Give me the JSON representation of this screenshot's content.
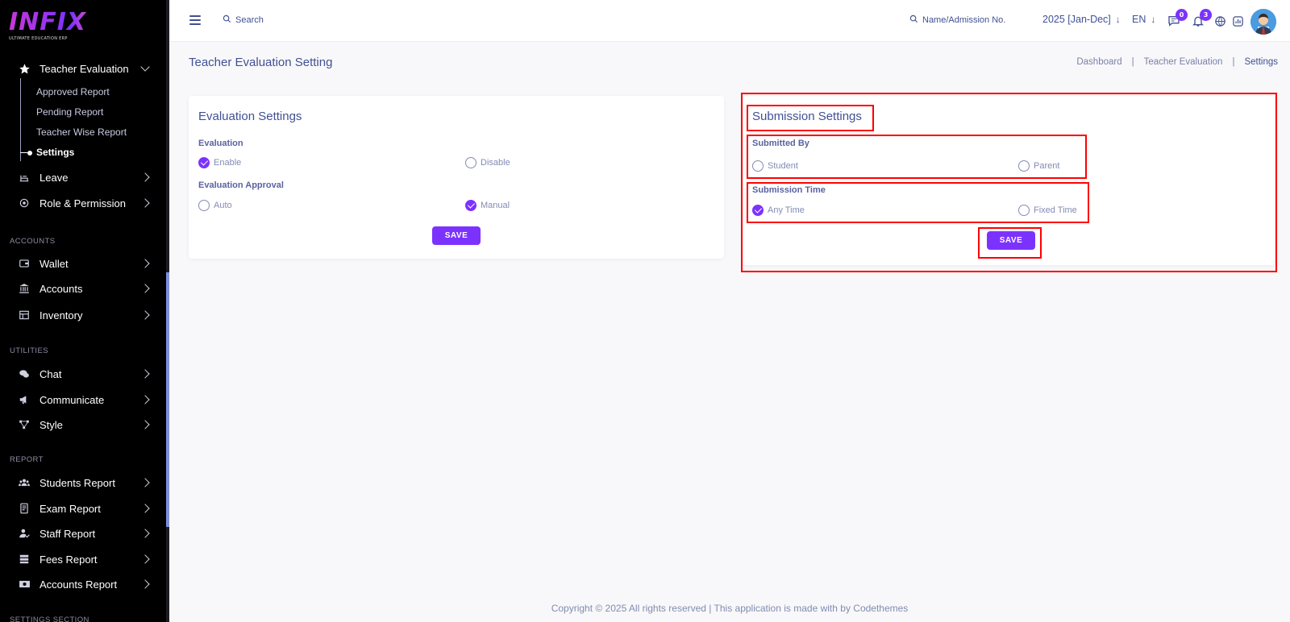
{
  "app": {
    "logo_text": "INFIX",
    "logo_tagline": "ULTIMATE EDUCATION ERP"
  },
  "header": {
    "search_label": "Search",
    "admission_search_label": "Name/Admission No.",
    "session": "2025 [Jan-Dec]",
    "language": "EN",
    "message_count": "0",
    "notification_count": "3"
  },
  "sidebar": {
    "teacher_evaluation": {
      "label": "Teacher Evaluation",
      "sub_items": [
        "Approved Report",
        "Pending Report",
        "Teacher Wise Report",
        "Settings"
      ]
    },
    "items_top": [
      {
        "label": "Leave",
        "icon": "leave-icon"
      },
      {
        "label": "Role & Permission",
        "icon": "role-permission-icon"
      }
    ],
    "sections": [
      {
        "title": "ACCOUNTS",
        "items": [
          "Wallet",
          "Accounts",
          "Inventory"
        ]
      },
      {
        "title": "UTILITIES",
        "items": [
          "Chat",
          "Communicate",
          "Style"
        ]
      },
      {
        "title": "REPORT",
        "items": [
          "Students Report",
          "Exam Report",
          "Staff Report",
          "Fees Report",
          "Accounts Report"
        ]
      },
      {
        "title": "SETTINGS SECTION",
        "items": []
      }
    ]
  },
  "page": {
    "title": "Teacher Evaluation Setting",
    "breadcrumb": [
      "Dashboard",
      "Teacher Evaluation",
      "Settings"
    ]
  },
  "evaluation_settings": {
    "title": "Evaluation Settings",
    "evaluation_label": "Evaluation",
    "evaluation_options": [
      "Enable",
      "Disable"
    ],
    "evaluation_selected": "Enable",
    "approval_label": "Evaluation Approval",
    "approval_options": [
      "Auto",
      "Manual"
    ],
    "approval_selected": "Manual",
    "save_label": "SAVE"
  },
  "submission_settings": {
    "title": "Submission Settings",
    "submitted_by_label": "Submitted By",
    "submitted_by_options": [
      "Student",
      "Parent"
    ],
    "submitted_by_selected": "",
    "submission_time_label": "Submission Time",
    "submission_time_options": [
      "Any Time",
      "Fixed Time"
    ],
    "submission_time_selected": "Any Time",
    "save_label": "SAVE"
  },
  "footer": {
    "text": "Copyright © 2025 All rights reserved | This application is made with by Codethemes"
  },
  "colors": {
    "accent": "#7c32ff",
    "text": "#415094",
    "highlight": "#ff0000",
    "sidebar_bg": "#000000"
  }
}
